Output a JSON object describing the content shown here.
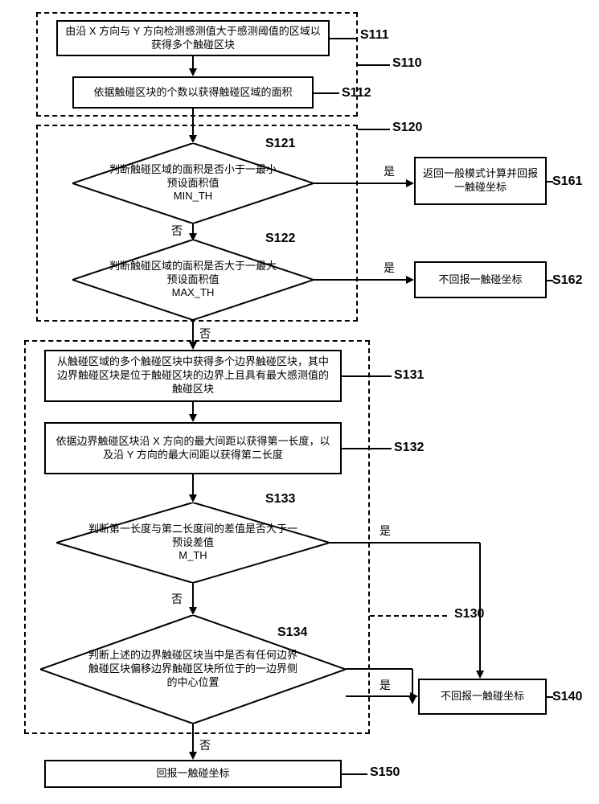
{
  "chart_data": {
    "type": "flowchart",
    "nodes": [
      {
        "id": "S111",
        "shape": "rect",
        "text": "由沿 X 方向与 Y 方向检测感测值大于感测阈值的区域以获得多个触碰区块"
      },
      {
        "id": "S112",
        "shape": "rect",
        "text": "依据触碰区块的个数以获得触碰区域的面积"
      },
      {
        "id": "S121",
        "shape": "diamond",
        "text": "判断触碰区域的面积是否小于一最小预设面积值\nMIN_TH"
      },
      {
        "id": "S122",
        "shape": "diamond",
        "text": "判断触碰区域的面积是否大于一最大预设面积值\nMAX_TH"
      },
      {
        "id": "S161",
        "shape": "rect",
        "text": "返回一般模式计算并回报一触碰坐标"
      },
      {
        "id": "S162",
        "shape": "rect",
        "text": "不回报一触碰坐标"
      },
      {
        "id": "S131",
        "shape": "rect",
        "text": "从触碰区域的多个触碰区块中获得多个边界触碰区块，其中边界触碰区块是位于触碰区块的边界上且具有最大感测值的触碰区块"
      },
      {
        "id": "S132",
        "shape": "rect",
        "text": "依据边界触碰区块沿 X 方向的最大间距以获得第一长度，以及沿 Y 方向的最大间距以获得第二长度"
      },
      {
        "id": "S133",
        "shape": "diamond",
        "text": "判断第一长度与第二长度间的差值是否大于一预设差值\nM_TH"
      },
      {
        "id": "S134",
        "shape": "diamond",
        "text": "判断上述的边界触碰区块当中是否有任何边界触碰区块偏移边界触碰区块所位于的一边界侧的中心位置"
      },
      {
        "id": "S140",
        "shape": "rect",
        "text": "不回报一触碰坐标"
      },
      {
        "id": "S150",
        "shape": "rect",
        "text": "回报一触碰坐标"
      }
    ],
    "groups": [
      {
        "id": "S110",
        "contains": [
          "S111",
          "S112"
        ]
      },
      {
        "id": "S120",
        "contains": [
          "S121",
          "S122"
        ]
      },
      {
        "id": "S130",
        "contains": [
          "S131",
          "S132",
          "S133",
          "S134"
        ]
      }
    ],
    "edges": [
      {
        "from": "S111",
        "to": "S112",
        "label": ""
      },
      {
        "from": "S112",
        "to": "S121",
        "label": ""
      },
      {
        "from": "S121",
        "to": "S122",
        "label": "否"
      },
      {
        "from": "S121",
        "to": "S161",
        "label": "是"
      },
      {
        "from": "S122",
        "to": "S131",
        "label": "否"
      },
      {
        "from": "S122",
        "to": "S162",
        "label": "是"
      },
      {
        "from": "S131",
        "to": "S132",
        "label": ""
      },
      {
        "from": "S132",
        "to": "S133",
        "label": ""
      },
      {
        "from": "S133",
        "to": "S134",
        "label": "否"
      },
      {
        "from": "S133",
        "to": "S140",
        "label": "是"
      },
      {
        "from": "S134",
        "to": "S150",
        "label": "否"
      },
      {
        "from": "S134",
        "to": "S140",
        "label": "是"
      }
    ]
  },
  "labels": {
    "s110": "S110",
    "s111": "S111",
    "s112": "S112",
    "s120": "S120",
    "s121": "S121",
    "s122": "S122",
    "s130": "S130",
    "s131": "S131",
    "s132": "S132",
    "s133": "S133",
    "s134": "S134",
    "s140": "S140",
    "s150": "S150",
    "s161": "S161",
    "s162": "S162",
    "yes": "是",
    "no": "否"
  }
}
